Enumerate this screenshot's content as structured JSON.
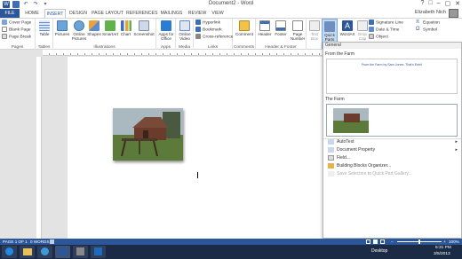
{
  "window": {
    "title": "Document2 - Word",
    "controls": [
      "?",
      "□",
      "–",
      "▢",
      "✕"
    ]
  },
  "tabs": [
    "FILE",
    "HOME",
    "INSERT",
    "DESIGN",
    "PAGE LAYOUT",
    "REFERENCES",
    "MAILINGS",
    "REVIEW",
    "VIEW"
  ],
  "active_tab": "INSERT",
  "user": {
    "name": "Elizabeth Nich"
  },
  "ribbon": {
    "pages": {
      "cover_page": "Cover Page",
      "blank_page": "Blank Page",
      "page_break": "Page Break",
      "label": "Pages"
    },
    "tables": {
      "table": "Table",
      "label": "Tables"
    },
    "illustrations": {
      "pictures": "Pictures",
      "online_pictures_1": "Online",
      "online_pictures_2": "Pictures",
      "shapes": "Shapes",
      "smartart": "SmartArt",
      "chart": "Chart",
      "screenshot": "Screenshot",
      "label": "Illustrations"
    },
    "apps": {
      "apps_1": "Apps for",
      "apps_2": "Office",
      "label": "Apps"
    },
    "media": {
      "video_1": "Online",
      "video_2": "Video",
      "label": "Media"
    },
    "links": {
      "hyperlink": "Hyperlink",
      "bookmark": "Bookmark",
      "cross_reference": "Cross-reference",
      "label": "Links"
    },
    "comments": {
      "comment": "Comment",
      "label": "Comments"
    },
    "header_footer": {
      "header": "Header",
      "footer": "Footer",
      "page_number_1": "Page",
      "page_number_2": "Number",
      "label": "Header & Footer"
    },
    "text": {
      "text_box_1": "Text",
      "text_box_2": "Box",
      "quick_parts_1": "Quick",
      "quick_parts_2": "Parts",
      "wordart": "WordArt",
      "drop_cap_1": "Drop",
      "drop_cap_2": "Cap",
      "signature_line": "Signature Line",
      "date_time": "Date & Time",
      "object": "Object"
    },
    "symbols": {
      "equation": "Equation",
      "symbol": "Symbol"
    }
  },
  "quick_parts": {
    "header": "General",
    "entries": [
      {
        "title": "From the Farm",
        "preview_text": "From the Farm by Sam Jones. That's Entri!"
      },
      {
        "title": "The Farm"
      }
    ],
    "menu": [
      {
        "label": "AutoText",
        "submenu": true,
        "enabled": true
      },
      {
        "label": "Document Property",
        "submenu": true,
        "enabled": true
      },
      {
        "label": "Field...",
        "submenu": false,
        "enabled": true
      },
      {
        "label": "Building Blocks Organizer...",
        "submenu": false,
        "enabled": true
      },
      {
        "label": "Save Selection to Quick Part Gallery...",
        "submenu": false,
        "enabled": false
      }
    ]
  },
  "status": {
    "page": "PAGE 1 OF 1",
    "words": "0 WORDS",
    "zoom": "100%"
  },
  "taskbar": {
    "desktop": "Desktop",
    "time": "6:31 PM",
    "date": "3/5/2013"
  },
  "colors": {
    "accent": "#2b579a",
    "taskbar": "#1c2b45"
  }
}
